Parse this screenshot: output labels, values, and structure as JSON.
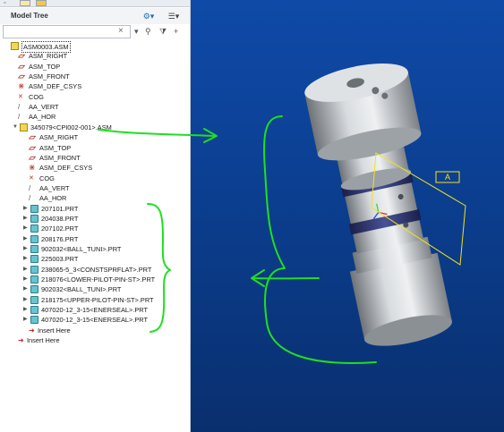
{
  "panel": {
    "title": "Model Tree",
    "search": {
      "value": "",
      "placeholder": ""
    },
    "tabs": [
      "tree-tab",
      "folder-tab",
      "favorites-tab"
    ]
  },
  "tree": [
    {
      "label": "ASM0003.ASM",
      "icon": "assembly-icon",
      "indent": 0,
      "expander": "",
      "selected": true
    },
    {
      "label": "ASM_RIGHT",
      "icon": "datum-plane-icon",
      "indent": 1,
      "expander": ""
    },
    {
      "label": "ASM_TOP",
      "icon": "datum-plane-icon",
      "indent": 1,
      "expander": ""
    },
    {
      "label": "ASM_FRONT",
      "icon": "datum-plane-icon",
      "indent": 1,
      "expander": ""
    },
    {
      "label": "ASM_DEF_CSYS",
      "icon": "csys-icon",
      "indent": 1,
      "expander": ""
    },
    {
      "label": "COG",
      "icon": "cog-icon",
      "indent": 1,
      "expander": ""
    },
    {
      "label": "AA_VERT",
      "icon": "axis-icon",
      "indent": 1,
      "expander": ""
    },
    {
      "label": "AA_HOR",
      "icon": "axis-icon",
      "indent": 1,
      "expander": ""
    },
    {
      "label": "345079<CPI002-001>.ASM",
      "icon": "assembly-icon",
      "indent": 1,
      "expander": "▼"
    },
    {
      "label": "ASM_RIGHT",
      "icon": "datum-plane-icon",
      "indent": 2,
      "expander": ""
    },
    {
      "label": "ASM_TOP",
      "icon": "datum-plane-icon",
      "indent": 2,
      "expander": ""
    },
    {
      "label": "ASM_FRONT",
      "icon": "datum-plane-icon",
      "indent": 2,
      "expander": ""
    },
    {
      "label": "ASM_DEF_CSYS",
      "icon": "csys-icon",
      "indent": 2,
      "expander": ""
    },
    {
      "label": "COG",
      "icon": "cog-icon",
      "indent": 2,
      "expander": ""
    },
    {
      "label": "AA_VERT",
      "icon": "axis-icon",
      "indent": 2,
      "expander": ""
    },
    {
      "label": "AA_HOR",
      "icon": "axis-icon",
      "indent": 2,
      "expander": ""
    },
    {
      "label": "207101.PRT",
      "icon": "part-icon",
      "indent": 2,
      "expander": "▶"
    },
    {
      "label": "204038.PRT",
      "icon": "part-icon",
      "indent": 2,
      "expander": "▶"
    },
    {
      "label": "207102.PRT",
      "icon": "part-icon",
      "indent": 2,
      "expander": "▶"
    },
    {
      "label": "208176.PRT",
      "icon": "part-icon",
      "indent": 2,
      "expander": "▶"
    },
    {
      "label": "902032<BALL_TUNI>.PRT",
      "icon": "part-icon",
      "indent": 2,
      "expander": "▶"
    },
    {
      "label": "225003.PRT",
      "icon": "part-icon",
      "indent": 2,
      "expander": "▶"
    },
    {
      "label": "238065-5_3<CONSTSPRFLAT>.PRT",
      "icon": "part-icon",
      "indent": 2,
      "expander": "▶"
    },
    {
      "label": "218076<LOWER-PILOT-PIN-ST>.PRT",
      "icon": "part-icon",
      "indent": 2,
      "expander": "▶"
    },
    {
      "label": "902032<BALL_TUNI>.PRT",
      "icon": "part-icon",
      "indent": 2,
      "expander": "▶"
    },
    {
      "label": "218175<UPPER-PILOT-PIN-ST>.PRT",
      "icon": "part-icon",
      "indent": 2,
      "expander": "▶"
    },
    {
      "label": "407020-12_3-15<ENERSEAL>.PRT",
      "icon": "part-icon",
      "indent": 2,
      "expander": "▶"
    },
    {
      "label": "407020-12_3-15<ENERSEAL>.PRT",
      "icon": "part-icon",
      "indent": 2,
      "expander": "▶"
    },
    {
      "label": "Insert Here",
      "icon": "insert-icon",
      "indent": 2,
      "expander": ""
    },
    {
      "label": "Insert Here",
      "icon": "insert-icon",
      "indent": 1,
      "expander": ""
    }
  ],
  "viewport": {
    "datum_label": "A",
    "colors": {
      "background": "#0b3d8d",
      "datum": "#f2e21a",
      "annotation": "#1ee01e"
    }
  }
}
